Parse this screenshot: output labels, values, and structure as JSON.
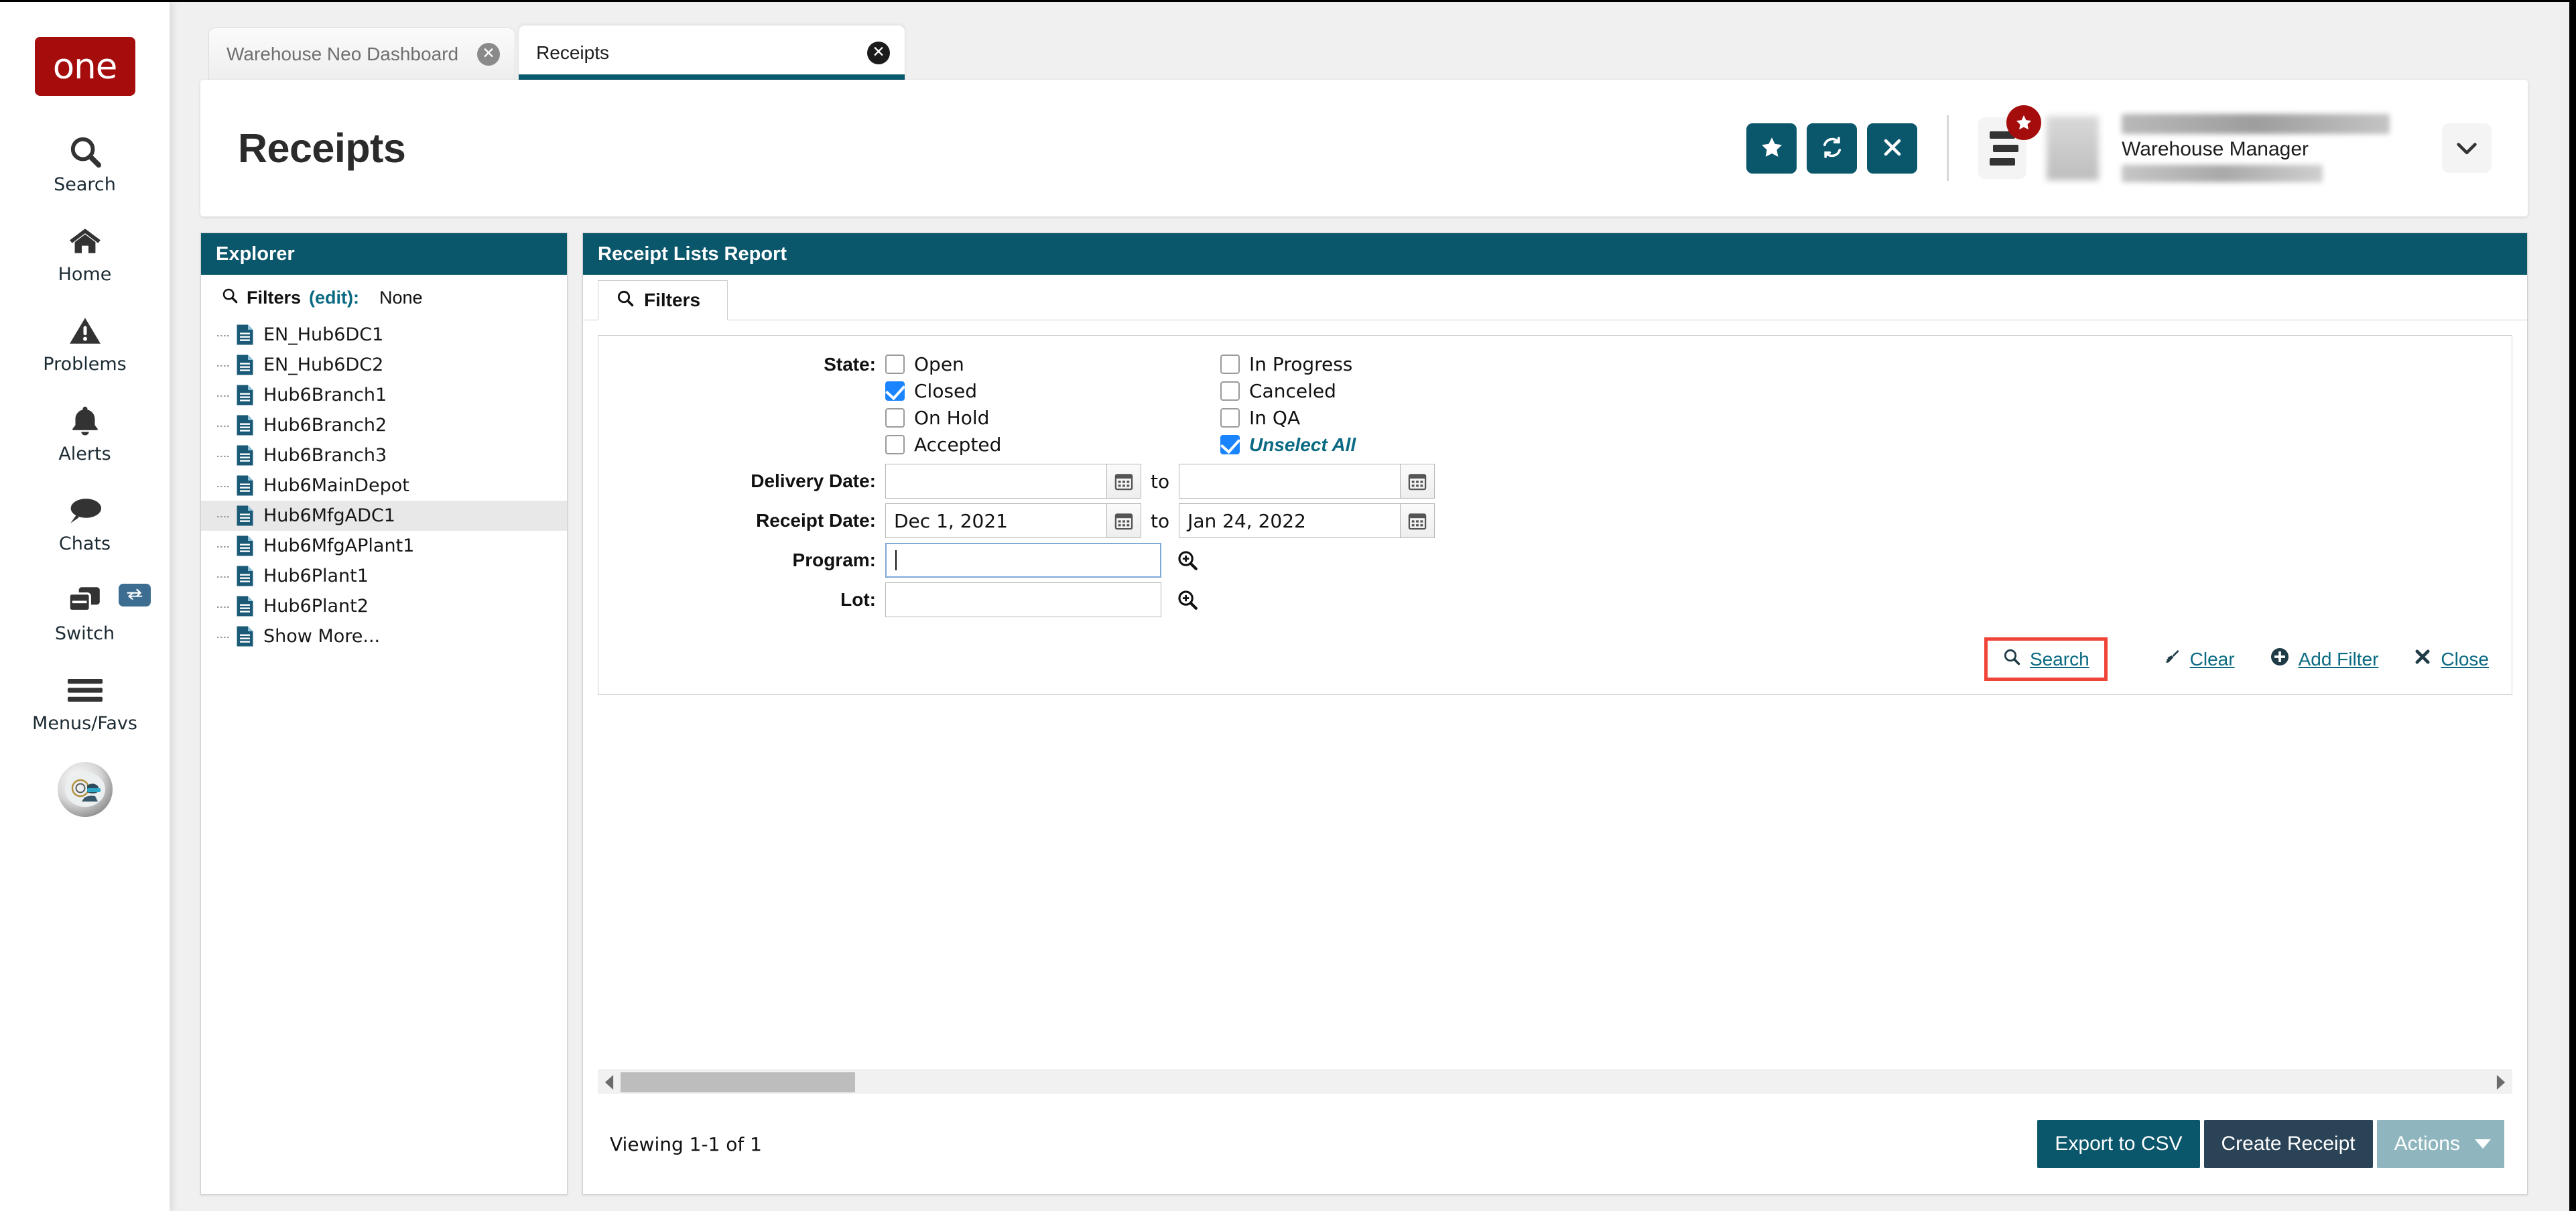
{
  "brand": {
    "logo_text": "one",
    "logo_color": "#a50c0c"
  },
  "theme": {
    "teal": "#0a566b",
    "link": "#0a6a82",
    "checkbox_blue": "#1a84ff",
    "highlight_red": "#f04438"
  },
  "rail": {
    "items": [
      {
        "label": "Search",
        "icon": "search-icon"
      },
      {
        "label": "Home",
        "icon": "home-icon"
      },
      {
        "label": "Problems",
        "icon": "warning-triangle-icon"
      },
      {
        "label": "Alerts",
        "icon": "bell-icon"
      },
      {
        "label": "Chats",
        "icon": "chat-bubble-icon"
      },
      {
        "label": "Switch",
        "icon": "switch-windows-icon"
      },
      {
        "label": "Menus/Favs",
        "icon": "hamburger-icon"
      }
    ],
    "bot_avatar": "robot-assistant-avatar"
  },
  "tabs": [
    {
      "label": "Warehouse Neo Dashboard",
      "active": false,
      "close": "✕"
    },
    {
      "label": "Receipts",
      "active": true,
      "close": "✕"
    }
  ],
  "header": {
    "title": "Receipts",
    "actions": [
      {
        "name": "favorite-button",
        "icon": "star-icon"
      },
      {
        "name": "refresh-button",
        "icon": "refresh-icon"
      },
      {
        "name": "close-button",
        "icon": "x-icon"
      }
    ],
    "favorites_menu": {
      "icon": "menu-favorites-icon",
      "badge_icon": "star-icon"
    },
    "user": {
      "name": "",
      "role": "Warehouse Manager",
      "org": ""
    },
    "caret": "▼"
  },
  "explorer": {
    "title": "Explorer",
    "filters_label": "Filters",
    "filters_edit": "(edit):",
    "filters_value": "None",
    "items": [
      {
        "label": "EN_Hub6DC1",
        "selected": false
      },
      {
        "label": "EN_Hub6DC2",
        "selected": false
      },
      {
        "label": "Hub6Branch1",
        "selected": false
      },
      {
        "label": "Hub6Branch2",
        "selected": false
      },
      {
        "label": "Hub6Branch3",
        "selected": false
      },
      {
        "label": "Hub6MainDepot",
        "selected": false
      },
      {
        "label": "Hub6MfgADC1",
        "selected": true
      },
      {
        "label": "Hub6MfgAPlant1",
        "selected": false
      },
      {
        "label": "Hub6Plant1",
        "selected": false
      },
      {
        "label": "Hub6Plant2",
        "selected": false
      },
      {
        "label": "Show More...",
        "selected": false
      }
    ]
  },
  "report": {
    "title": "Receipt Lists Report",
    "filters_tab": "Filters",
    "filters": {
      "state_label": "State:",
      "state_left": [
        {
          "label": "Open",
          "checked": false
        },
        {
          "label": "Closed",
          "checked": true
        },
        {
          "label": "On Hold",
          "checked": false
        },
        {
          "label": "Accepted",
          "checked": false
        }
      ],
      "state_right": [
        {
          "label": "In Progress",
          "checked": false,
          "style": "normal"
        },
        {
          "label": "Canceled",
          "checked": false,
          "style": "normal"
        },
        {
          "label": "In QA",
          "checked": false,
          "style": "normal"
        },
        {
          "label": "Unselect All",
          "checked": true,
          "style": "link-italic"
        }
      ],
      "delivery_date_label": "Delivery Date:",
      "delivery_date_from": "",
      "delivery_date_to": "",
      "receipt_date_label": "Receipt Date:",
      "receipt_date_from": "Dec 1, 2021",
      "receipt_date_to": "Jan 24, 2022",
      "to_word": "to",
      "program_label": "Program:",
      "program_value": "",
      "lot_label": "Lot:",
      "lot_value": ""
    },
    "actions": [
      {
        "label": "Search",
        "icon": "search-icon",
        "highlighted": true
      },
      {
        "label": "Clear",
        "icon": "broom-icon",
        "highlighted": false
      },
      {
        "label": "Add Filter",
        "icon": "plus-circle-icon",
        "highlighted": false
      },
      {
        "label": "Close",
        "icon": "x-icon",
        "highlighted": false
      }
    ]
  },
  "footer": {
    "viewing": "Viewing 1-1 of 1",
    "export_label": "Export to CSV",
    "create_label": "Create Receipt",
    "actions_label": "Actions",
    "actions_caret": "▼"
  }
}
